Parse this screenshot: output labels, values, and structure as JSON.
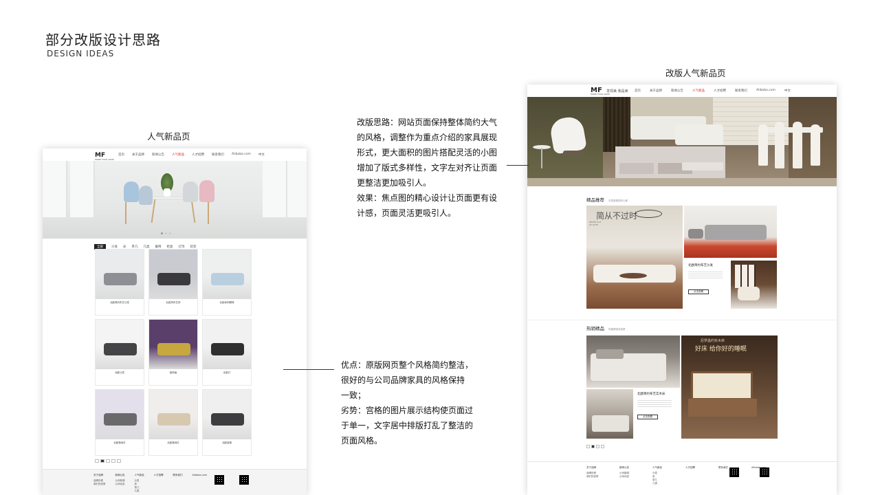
{
  "slide": {
    "title": "部分改版设计思路",
    "subtitle": "DESIGN IDEAS"
  },
  "old_page": {
    "caption": "人气新品页",
    "nav": {
      "logo": "MF",
      "logo_sub": "MORE FOUR GRDE",
      "links": [
        "首页",
        "关于品牌",
        "新闻公告",
        "人气新品",
        "人才招聘",
        "联系我们",
        "Alibaba.com",
        "中文"
      ],
      "active": "人气新品"
    },
    "tabs": [
      "全部",
      "沙发",
      "床",
      "茶几",
      "几类",
      "餐椅",
      "柜类",
      "灯饰",
      "软装"
    ],
    "products": [
      {
        "title": "北欧简约布艺沙发",
        "desc": "·"
      },
      {
        "title": "北欧风布艺床",
        "desc": "·"
      },
      {
        "title": "北欧休闲餐椅",
        "desc": "·"
      },
      {
        "title": "北欧沙发",
        "desc": "·"
      },
      {
        "title": "装饰画",
        "desc": "·"
      },
      {
        "title": "北欧灯",
        "desc": "·"
      },
      {
        "title": "北欧落地灯",
        "desc": "·"
      },
      {
        "title": "北欧落地灯",
        "desc": "·"
      },
      {
        "title": "北欧摇椅",
        "desc": "·"
      }
    ],
    "footer_cols": [
      {
        "head": "关于品牌",
        "items": [
          "品牌历程",
          "我们的优势"
        ]
      },
      {
        "head": "新闻公告",
        "items": [
          "公司新闻",
          "公司动态"
        ]
      },
      {
        "head": "人气新品",
        "items": [
          "沙发",
          "床",
          "茶几",
          "几类"
        ]
      },
      {
        "head": "人才招聘",
        "items": []
      },
      {
        "head": "联系我们",
        "items": []
      },
      {
        "head": "Alibaba.com",
        "items": []
      }
    ]
  },
  "new_page": {
    "caption": "改版人气新品页",
    "nav": {
      "logo": "MF",
      "logo_sub": "MORE FOUR GRDE",
      "brand": "发现美 我是美",
      "links": [
        "首页",
        "关于品牌",
        "新闻公告",
        "人气新品",
        "人才招聘",
        "联系我们",
        "Alibaba.com",
        "中文"
      ],
      "active": "人气新品"
    },
    "section1": {
      "title": "精品推荐",
      "sub": "与您选择的好心家",
      "poster_text": "简从不过时",
      "poster_sub": "NEVER OUT OF DATE",
      "product_title": "北欧简约布艺沙发",
      "button": "点击查看"
    },
    "section2": {
      "title": "热销精品",
      "sub": "你值得选本品质",
      "banner_title": "尼罗昌约实木床",
      "banner_text": "好床 给你好的睡眠",
      "product_title": "北欧简约布艺实木床",
      "button": "点击查看"
    },
    "footer_cols": [
      {
        "head": "关于品牌",
        "items": [
          "品牌历程",
          "我们的优势"
        ]
      },
      {
        "head": "新闻公告",
        "items": [
          "公司新闻",
          "公司动态"
        ]
      },
      {
        "head": "人气新品",
        "items": [
          "沙发",
          "床",
          "茶几",
          "几类"
        ]
      },
      {
        "head": "人才招聘",
        "items": []
      },
      {
        "head": "联系我们",
        "items": []
      },
      {
        "head": "Alibaba.com",
        "items": []
      }
    ]
  },
  "notes": {
    "redesign": [
      "改版思路：网站页面保持整体简约大气",
      "的风格，调整作为重点介绍的家具展现",
      "形式，更大面积的图片搭配灵活的小图",
      "增加了版式多样性，文字左对齐让页面",
      "更整洁更加吸引人。",
      "效果：焦点图的精心设计让页面更有设",
      "计感，页面灵活更吸引人。"
    ],
    "original": [
      "优点：原版网页整个风格简约整洁，",
      "很好的与公司品牌家具的风格保持",
      "一致；",
      "劣势：宫格的图片展示结构使页面过",
      "于单一，文字居中排版打乱了整洁的",
      "页面风格。"
    ]
  }
}
